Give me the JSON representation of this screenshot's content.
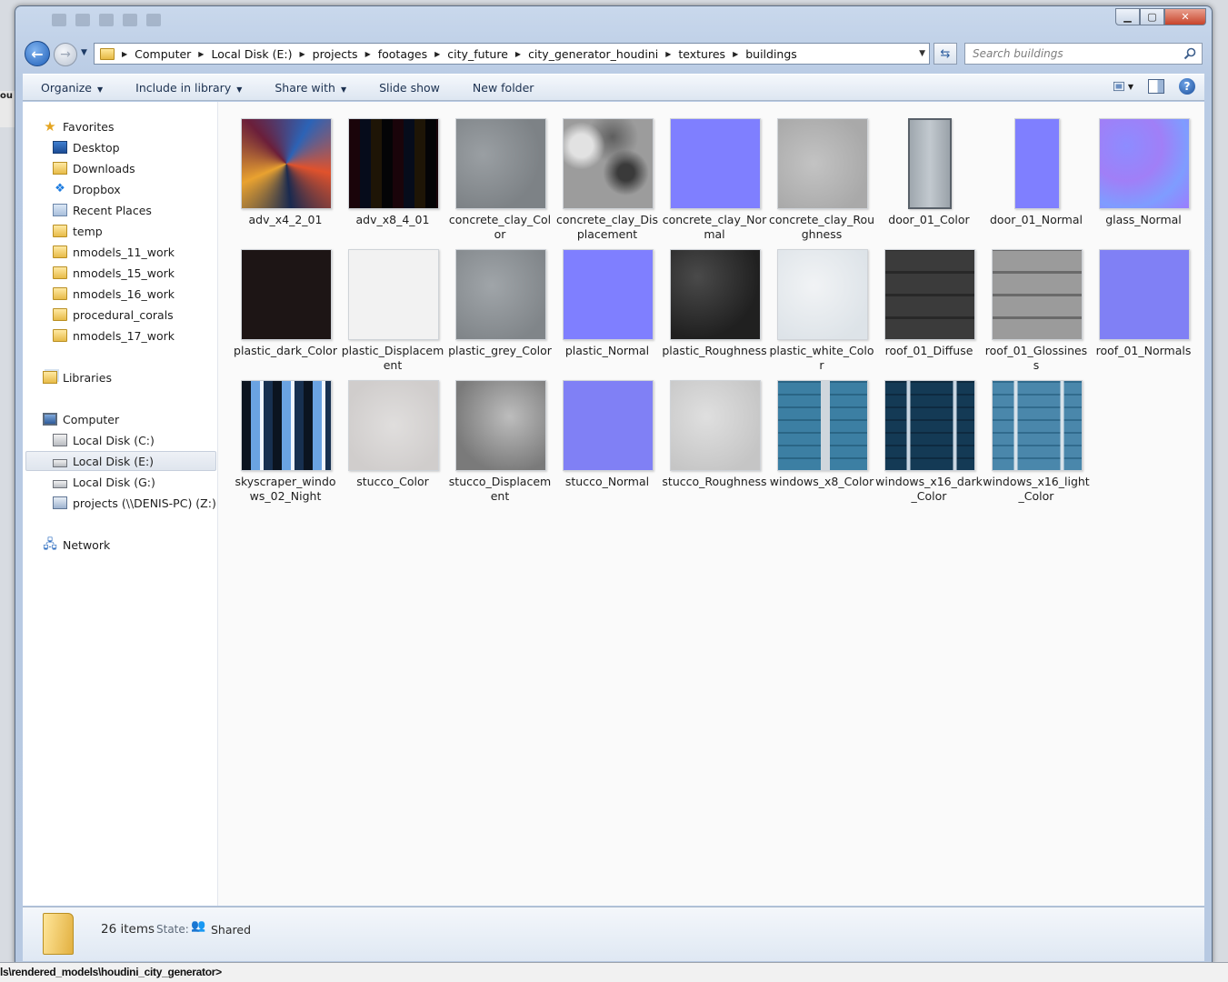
{
  "window": {
    "breadcrumb": [
      "Computer",
      "Local Disk (E:)",
      "projects",
      "footages",
      "city_future",
      "city_generator_houdini",
      "textures",
      "buildings"
    ],
    "search_placeholder": "Search buildings"
  },
  "toolbar": {
    "organize": "Organize",
    "include_in_library": "Include in library",
    "share_with": "Share with",
    "slide_show": "Slide show",
    "new_folder": "New folder"
  },
  "nav": {
    "favorites": "Favorites",
    "favorites_items": [
      "Desktop",
      "Downloads",
      "Dropbox",
      "Recent Places",
      "temp",
      "nmodels_11_work",
      "nmodels_15_work",
      "nmodels_16_work",
      "procedural_corals",
      "nmodels_17_work"
    ],
    "libraries": "Libraries",
    "computer": "Computer",
    "computer_items": [
      "Local Disk (C:)",
      "Local Disk (E:)",
      "Local Disk (G:)",
      "projects (\\\\DENIS-PC) (Z:)"
    ],
    "network": "Network"
  },
  "files": [
    {
      "name": "adv_x4_2_01"
    },
    {
      "name": "adv_x8_4_01"
    },
    {
      "name": "concrete_clay_Color"
    },
    {
      "name": "concrete_clay_Displacement"
    },
    {
      "name": "concrete_clay_Normal"
    },
    {
      "name": "concrete_clay_Roughness"
    },
    {
      "name": "door_01_Color"
    },
    {
      "name": "door_01_Normal"
    },
    {
      "name": "glass_Normal"
    },
    {
      "name": "plastic_dark_Color"
    },
    {
      "name": "plastic_Displacement"
    },
    {
      "name": "plastic_grey_Color"
    },
    {
      "name": "plastic_Normal"
    },
    {
      "name": "plastic_Roughness"
    },
    {
      "name": "plastic_white_Color"
    },
    {
      "name": "roof_01_Diffuse"
    },
    {
      "name": "roof_01_Glossiness"
    },
    {
      "name": "roof_01_Normals"
    },
    {
      "name": "skyscraper_windows_02_Night"
    },
    {
      "name": "stucco_Color"
    },
    {
      "name": "stucco_Displacement"
    },
    {
      "name": "stucco_Normal"
    },
    {
      "name": "stucco_Roughness"
    },
    {
      "name": "windows_x8_Color"
    },
    {
      "name": "windows_x16_dark_Color"
    },
    {
      "name": "windows_x16_light_Color"
    }
  ],
  "status": {
    "count": "26 items",
    "state_label": "State:",
    "state": "Shared"
  },
  "taskbar": {
    "path_text": "ls\\rendered_models\\houdini_city_generator>"
  },
  "left_stub_text": "ou"
}
